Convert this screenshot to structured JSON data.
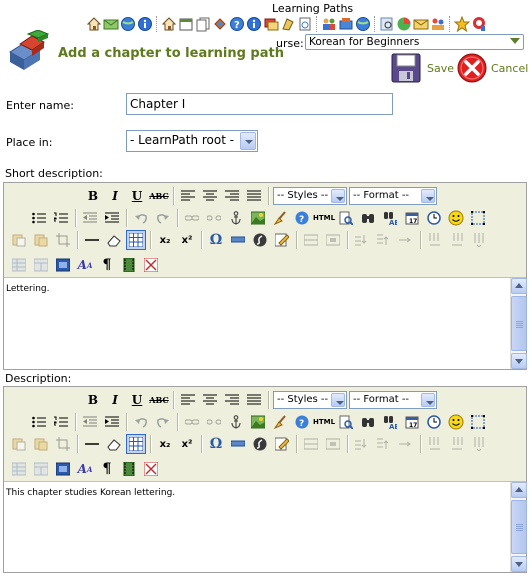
{
  "header": {
    "section_title": "Learning Paths",
    "page_title": "Add a chapter to learning path",
    "course_label": "urse:",
    "course_selected": "Korean for Beginners",
    "save_label": "Save",
    "cancel_label": "Cancel"
  },
  "nav_icons": [
    "home-icon",
    "email-icon",
    "globe-icon",
    "info-icon",
    "home-icon",
    "calendar-icon",
    "documents-icon",
    "link-icon",
    "help-icon",
    "info-icon",
    "forum-icon",
    "learnpath-icon",
    "quiz-icon",
    "users-icon",
    "globe-icon",
    "chart-icon",
    "search-icon",
    "pie-chart-icon",
    "mail-icon",
    "groups-icon",
    "star-icon",
    "tools-icon"
  ],
  "form": {
    "name_label": "Enter name:",
    "name_value": "Chapter I",
    "place_label": "Place in:",
    "place_value": "- LearnPath root -",
    "short_desc_label": "Short description:",
    "desc_label": "Description:"
  },
  "editor": {
    "styles_placeholder": "-- Styles --",
    "format_placeholder": "-- Format --",
    "sub_label": "x₂",
    "sup_label": "x²",
    "html_label": "HTML",
    "omega_label": "Ω",
    "pilcrow_label": "¶",
    "bold_label": "B",
    "italic_label": "I",
    "underline_label": "U",
    "strike_label": "ABC"
  },
  "short_desc_content": "Lettering.",
  "desc_content": "This chapter studies Korean lettering."
}
